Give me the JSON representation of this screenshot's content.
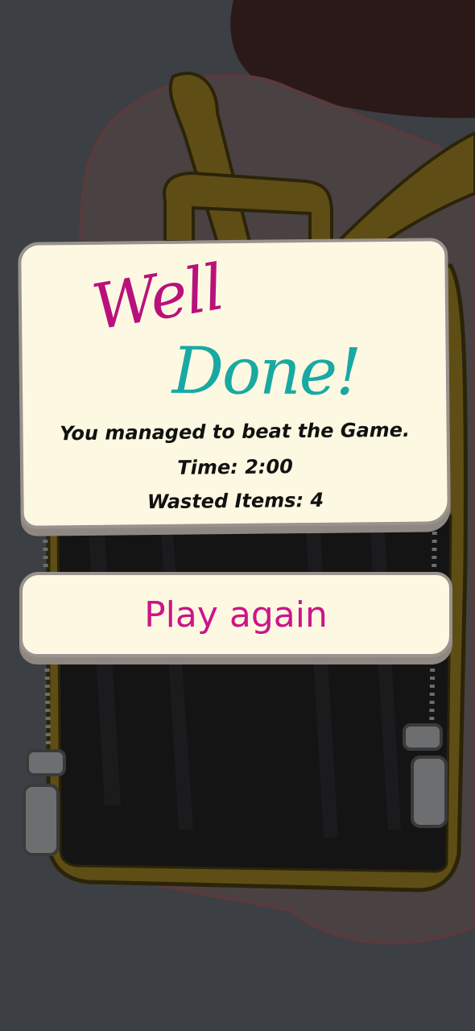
{
  "result": {
    "title_line1": "Well",
    "title_line2": "Done!",
    "message": "You managed to beat the Game.",
    "time_label": "Time:",
    "time_value": "2:00",
    "wasted_label": "Wasted Items:",
    "wasted_value": "4"
  },
  "actions": {
    "play_again": "Play again"
  },
  "colors": {
    "title_magenta": "#b9117c",
    "title_teal": "#18a9a3",
    "card_bg": "#fdf8e1",
    "button_text": "#cc148a",
    "overlay": "#3c3f44"
  }
}
